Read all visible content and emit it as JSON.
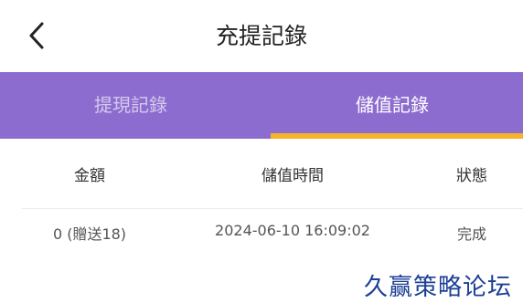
{
  "header": {
    "title": "充提記錄"
  },
  "tabs": [
    {
      "label": "提現記錄",
      "active": false
    },
    {
      "label": "儲值記錄",
      "active": true
    }
  ],
  "colors": {
    "tab_bar": "#8d6ccf",
    "active_indicator": "#f6b32a",
    "inactive_tab_text": "#d5c9ee"
  },
  "table": {
    "columns": [
      "金額",
      "儲值時間",
      "狀態"
    ],
    "rows": [
      {
        "amount": "0 (贈送18)",
        "time": "2024-06-10 16:09:02",
        "status": "完成"
      }
    ]
  },
  "watermark": "久赢策略论坛"
}
